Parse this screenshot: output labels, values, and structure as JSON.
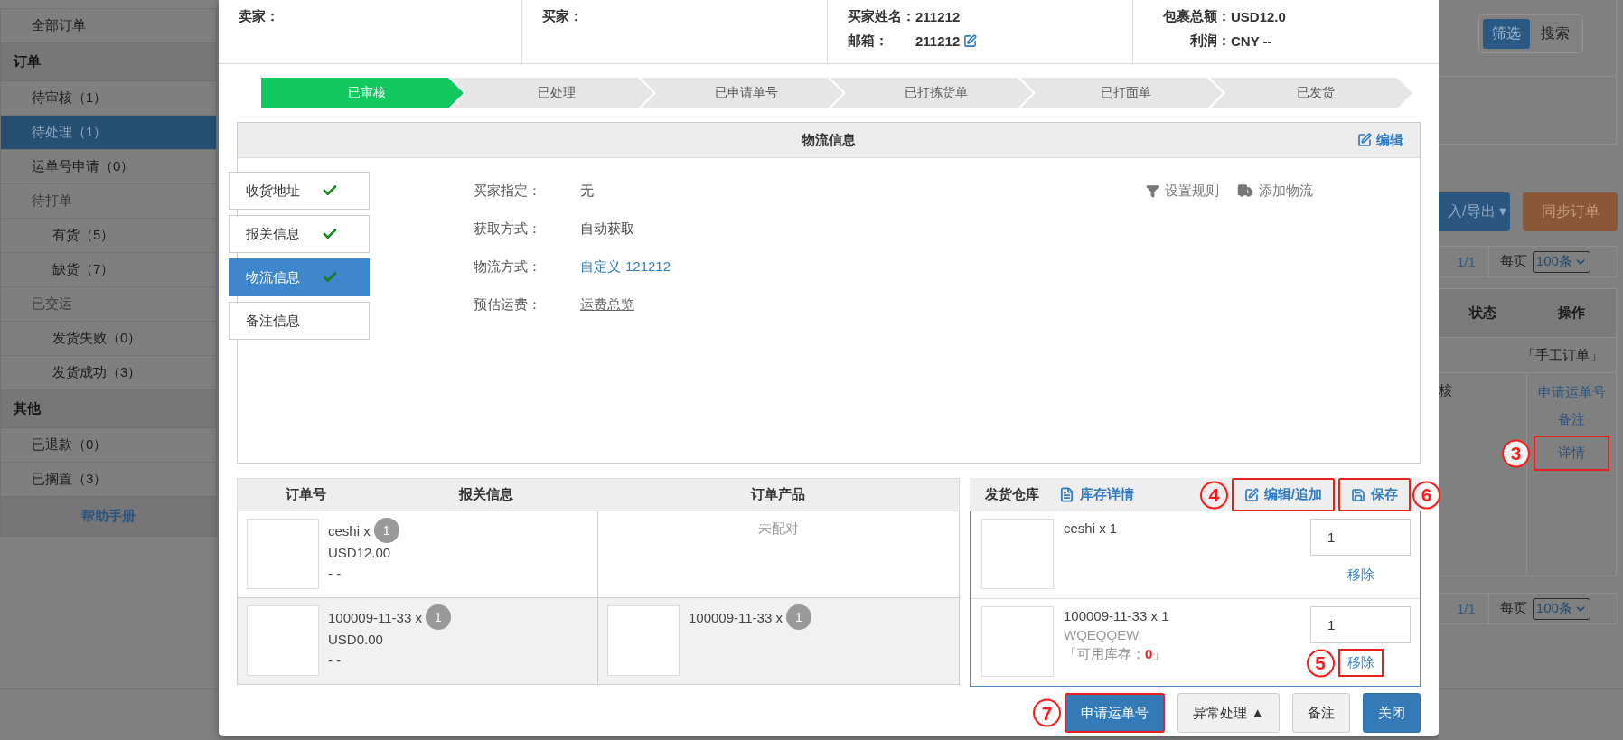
{
  "sidebar": {
    "top_items": [
      {
        "label": "全部订单",
        "selected": false
      }
    ],
    "sections": [
      {
        "title": "订单",
        "items": [
          {
            "label": "待审核（1）",
            "selected": false
          },
          {
            "label": "待处理（1）",
            "selected": true
          },
          {
            "label": "运单号申请（0）",
            "selected": false
          },
          {
            "label": "待打单",
            "selected": false,
            "children": [
              {
                "label": "有货（5）",
                "selected": false
              },
              {
                "label": "缺货（7）",
                "selected": false
              }
            ]
          },
          {
            "label": "已交运",
            "selected": false,
            "children": [
              {
                "label": "发货失败（0）",
                "selected": false
              },
              {
                "label": "发货成功（3）",
                "selected": false
              }
            ]
          }
        ]
      },
      {
        "title": "其他",
        "items": [
          {
            "label": "已退款（0）",
            "selected": false
          },
          {
            "label": "已搁置（3）",
            "selected": false
          }
        ]
      }
    ],
    "help_link": "帮助手册"
  },
  "order_summary": [
    {
      "lines": [
        {
          "label": "卖家："
        }
      ]
    },
    {
      "lines": [
        {
          "label": "买家："
        }
      ]
    },
    {
      "lines": [
        {
          "label": "买家姓名：",
          "value": "211212"
        },
        {
          "label": "邮箱：",
          "value": "211212",
          "editable": true
        }
      ]
    },
    {
      "lines": [
        {
          "label": "包裹总额：",
          "value": "USD12.0"
        },
        {
          "label": "利润：",
          "value": "CNY --"
        }
      ]
    }
  ],
  "steps": [
    {
      "label": "已审核",
      "selected": true
    },
    {
      "label": "已处理",
      "selected": false
    },
    {
      "label": "已申请单号",
      "selected": false
    },
    {
      "label": "已打拣货单",
      "selected": false
    },
    {
      "label": "已打面单",
      "selected": false
    },
    {
      "label": "已发货",
      "selected": false
    }
  ],
  "logistics": {
    "title": "物流信息",
    "edit_link": "编辑",
    "tabs": [
      {
        "label": "收货地址",
        "complete": true,
        "selected": false
      },
      {
        "label": "报关信息",
        "complete": true,
        "selected": false
      },
      {
        "label": "物流信息",
        "complete": true,
        "selected": true
      },
      {
        "label": "备注信息",
        "complete": false,
        "selected": false
      }
    ],
    "fields": [
      {
        "label": "买家指定：",
        "value": "无",
        "kind": "text"
      },
      {
        "label": "获取方式：",
        "value": "自动获取",
        "kind": "text"
      },
      {
        "label": "物流方式：",
        "value": "自定义-121212",
        "kind": "link"
      },
      {
        "label": "预估运费：",
        "value": "运费总览",
        "kind": "underlined"
      }
    ],
    "actions": [
      {
        "label": "设置规则",
        "kind": "filter"
      },
      {
        "label": "添加物流",
        "kind": "truck"
      }
    ]
  },
  "order_table": {
    "columns": [
      "订单号",
      "报关信息",
      "订单产品"
    ],
    "rows": [
      {
        "declared": {
          "name": "ceshi x",
          "quantity": "1",
          "price": "USD12.00",
          "note": "- -"
        },
        "product": {
          "kind": "unmatched",
          "text": "未配对"
        }
      },
      {
        "declared": {
          "name": "100009-11-33 x",
          "quantity": "1",
          "price": "USD0.00",
          "note": "- -"
        },
        "product": {
          "kind": "item",
          "name": "100009-11-33 x",
          "quantity": "1"
        }
      }
    ]
  },
  "warehouse": {
    "title": "发货仓库",
    "stock_link": "库存详情",
    "edit_button": {
      "label": "编辑/追加",
      "callout": "4"
    },
    "save_button": {
      "label": "保存",
      "callout": "6"
    },
    "items": [
      {
        "name": "ceshi x 1",
        "quantity": "1",
        "remove": {
          "label": "移除"
        }
      },
      {
        "name": "100009-11-33 x 1",
        "sku": "WQEQQEW",
        "stock": "「可用库存：**0**」",
        "quantity": "1",
        "remove": {
          "label": "移除",
          "callout": "5"
        }
      }
    ]
  },
  "footer_buttons": [
    {
      "label": "申请运单号",
      "kind": "primary",
      "callout": "7"
    },
    {
      "label": "异常处理 ▲",
      "kind": "default"
    },
    {
      "label": "备注",
      "kind": "default"
    },
    {
      "label": "关闭",
      "kind": "primary"
    }
  ],
  "background": {
    "view_toggle": [
      {
        "label": "筛选",
        "selected": true
      },
      {
        "label": "搜索",
        "selected": false
      }
    ],
    "import_export_button": "入/导出 ▾",
    "sync_button": "同步订单",
    "pagers": [
      {
        "pages": "1/1",
        "per_page_label": "每页",
        "per_page": "100条"
      },
      {
        "pages": "1/1",
        "per_page_label": "每页",
        "per_page": "100条"
      }
    ],
    "columns": [
      "状态",
      "操作"
    ],
    "group_row": "「手工订单」",
    "status": "核",
    "actions": [
      {
        "label": "申请运单号"
      },
      {
        "label": "备注"
      },
      {
        "label": "详情",
        "callout": "3"
      }
    ]
  }
}
